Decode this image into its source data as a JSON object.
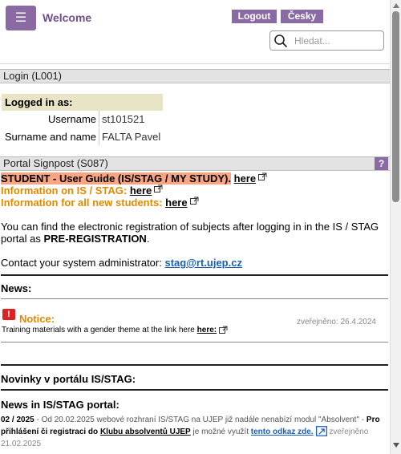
{
  "header": {
    "welcome": "Welcome",
    "logout": "Logout",
    "language": "Česky",
    "search_placeholder": "Hledat..."
  },
  "login_panel": {
    "title": "Login (L001)",
    "logged_as": "Logged in as:",
    "rows": [
      {
        "label": "Username",
        "value": "st101521"
      },
      {
        "label": "Surname and name",
        "value": "FALTA Pavel"
      }
    ]
  },
  "signpost": {
    "title": "Portal Signpost (S087)",
    "help": "?",
    "guide": "STUDENT - User Guide (IS/STAG / MY STUDY).",
    "guide_link": "here",
    "info_stag": "Information on IS / STAG:",
    "info_stag_link": "here",
    "info_new": "Information for all new students:",
    "info_new_link": "here",
    "prereg_text": "You can find the electronic registration of subjects after logging in in the IS / STAG portal as",
    "prereg_bold": "PRE-REGISTRATION",
    "prereg_end": ".",
    "contact_text": "Contact your system administrator:",
    "contact_email": "stag@rt.ujep.cz"
  },
  "news": {
    "title": "News:",
    "notice_title": "Notice:",
    "notice_date": "zveřejněno: 26.4.2024",
    "notice_text": "Training materials with a gender theme at the link here",
    "notice_link": "here:"
  },
  "portal_news": {
    "title": "Novinky v portálu IS/STAG:",
    "subtitle": "News in IS/STAG portal:",
    "item_no": "02 / 2025",
    "item_text": "- Od 20.02.2025 webové rozhraní IS/STAG na UJEP již nadále nenabízí modul \"Absolvent\" -",
    "item_bold": "Pro přihlášení či registraci do",
    "item_club": "Klubu absolventů UJEP",
    "item_mid": "je možné využít",
    "item_link": "tento odkaz zde.",
    "item_date": "zveřejněno 21.02.2025"
  }
}
